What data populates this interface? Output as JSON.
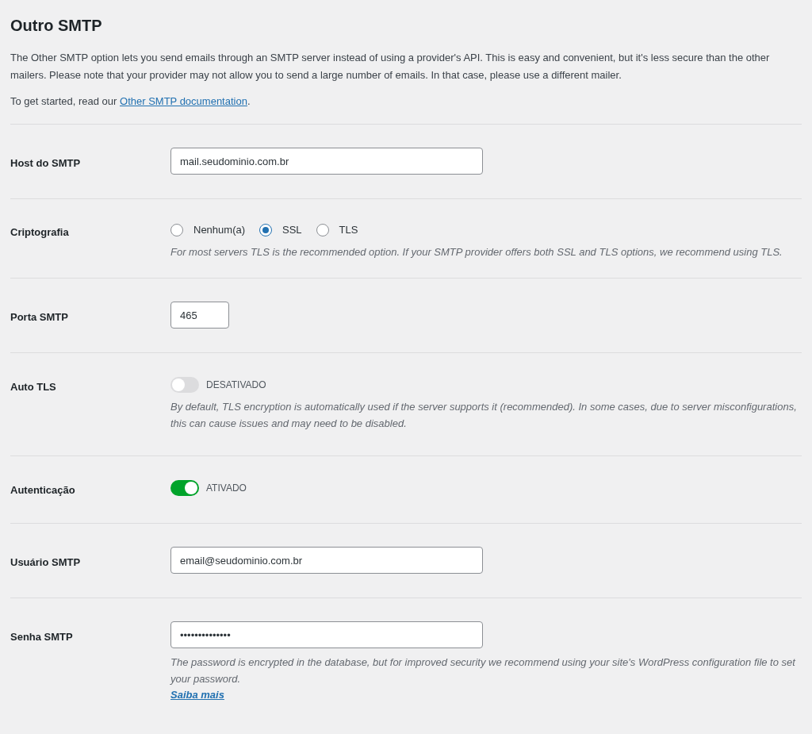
{
  "title": "Outro SMTP",
  "intro": "The Other SMTP option lets you send emails through an SMTP server instead of using a provider's API. This is easy and convenient, but it's less secure than the other mailers. Please note that your provider may not allow you to send a large number of emails. In that case, please use a different mailer.",
  "docs": {
    "prefix": "To get started, read our ",
    "link": "Other SMTP documentation",
    "suffix": "."
  },
  "rows": [
    {
      "kind": "text",
      "label": "Host do SMTP",
      "value": "mail.seudominio.com.br"
    },
    {
      "kind": "radio",
      "label": "Criptografia",
      "options": [
        {
          "label": "Nenhum(a)",
          "selected": false
        },
        {
          "label": "SSL",
          "selected": true
        },
        {
          "label": "TLS",
          "selected": false
        }
      ],
      "help": "For most servers TLS is the recommended option. If your SMTP provider offers both SSL and TLS options, we recommend using TLS."
    },
    {
      "kind": "number",
      "label": "Porta SMTP",
      "value": "465"
    },
    {
      "kind": "toggle",
      "label": "Auto TLS",
      "on": false,
      "state_label": "DESATIVADO",
      "help": "By default, TLS encryption is automatically used if the server supports it (recommended). In some cases, due to server misconfigurations, this can cause issues and may need to be disabled."
    },
    {
      "kind": "toggle",
      "label": "Autenticação",
      "on": true,
      "state_label": "ATIVADO"
    },
    {
      "kind": "text",
      "label": "Usuário SMTP",
      "value": "email@seudominio.com.br"
    },
    {
      "kind": "text",
      "label": "Senha SMTP",
      "value": "••••••••••••••",
      "help": "The password is encrypted in the database, but for improved security we recommend using your site's WordPress configuration file to set your password.",
      "link": "Saiba mais"
    }
  ]
}
